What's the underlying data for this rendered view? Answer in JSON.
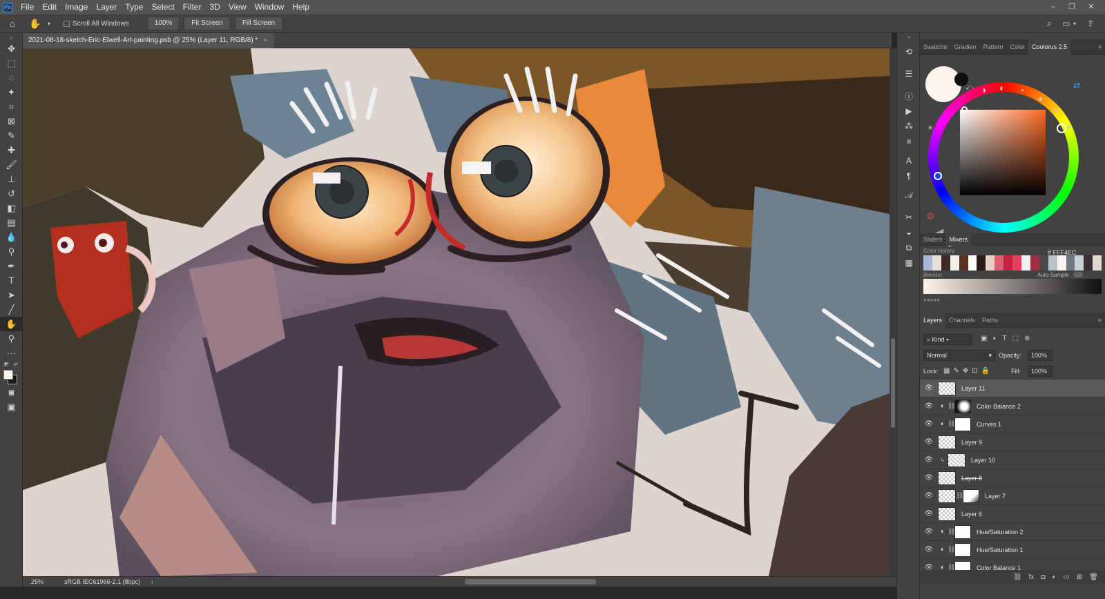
{
  "app": {
    "logo": "Ps"
  },
  "menu": [
    "File",
    "Edit",
    "Image",
    "Layer",
    "Type",
    "Select",
    "Filter",
    "3D",
    "View",
    "Window",
    "Help"
  ],
  "window_controls": {
    "minimize": "–",
    "restore": "❐",
    "close": "✕"
  },
  "options": {
    "scroll_all_label": "Scroll All Windows",
    "zoom_value": "100%",
    "fit_screen": "Fit Screen",
    "fill_screen": "Fill Screen"
  },
  "document": {
    "tab_title": "2021-08-18-sketch-Eric-Elwell-Art-painting.psb @ 25% (Layer 11, RGB/8) *",
    "close": "×"
  },
  "status": {
    "zoom": "25%",
    "profile": "sRGB IEC61966-2.1 (8bpc)",
    "arrow": "›"
  },
  "color_panel": {
    "tabs": [
      "Swatche",
      "Gradien",
      "Pattern",
      "Color",
      "Coolorus 2.5"
    ],
    "active_tab": "Coolorus 2.5",
    "foreground_color": "#FFF4EC",
    "hex_label": "# FFF4EC",
    "subtabs": [
      "Sliders",
      "Mixers"
    ],
    "active_subtab": "Mixers",
    "history_label": "Color history",
    "history_colors": [
      "#a8b8d8",
      "#e8e0d8",
      "#3a2a28",
      "#f4eee8",
      "#5a3020",
      "#ffffff",
      "#2a1a18",
      "#e8d0c8",
      "#d86070",
      "#c82040",
      "#e84060",
      "#f0f0f0",
      "#a03040",
      "#4a4a4a",
      "#b8c0c8",
      "#f8f4f0",
      "#707880",
      "#c8d0d8",
      "#3a3030",
      "#e0d8d0"
    ],
    "blender_label": "Blender",
    "auto_sample": "Auto Sample"
  },
  "layers_panel": {
    "tabs": [
      "Layers",
      "Channels",
      "Paths"
    ],
    "active_tab": "Layers",
    "kind_label": "Kind",
    "blend_mode": "Normal",
    "opacity_label": "Opacity:",
    "opacity": "100%",
    "lock_label": "Lock:",
    "fill_label": "Fill:",
    "fill": "100%",
    "layers": [
      {
        "name": "Layer 11",
        "type": "pixel",
        "selected": true
      },
      {
        "name": "Color Balance 2",
        "type": "adjustment"
      },
      {
        "name": "Curves 1",
        "type": "adjustment"
      },
      {
        "name": "Layer 9",
        "type": "pixel"
      },
      {
        "name": "Layer 10",
        "type": "clipped"
      },
      {
        "name": "Layer 8",
        "type": "pixel",
        "struck": true
      },
      {
        "name": "Layer 7",
        "type": "masked"
      },
      {
        "name": "Layer 6",
        "type": "pixel"
      },
      {
        "name": "Hue/Saturation 2",
        "type": "adjustment"
      },
      {
        "name": "Hue/Saturation 1",
        "type": "adjustment"
      },
      {
        "name": "Color Balance 1",
        "type": "adjustment"
      }
    ]
  },
  "icons": {
    "eye": "👁",
    "adjust": "◐",
    "chain": "⛓",
    "lock": "🔒"
  }
}
